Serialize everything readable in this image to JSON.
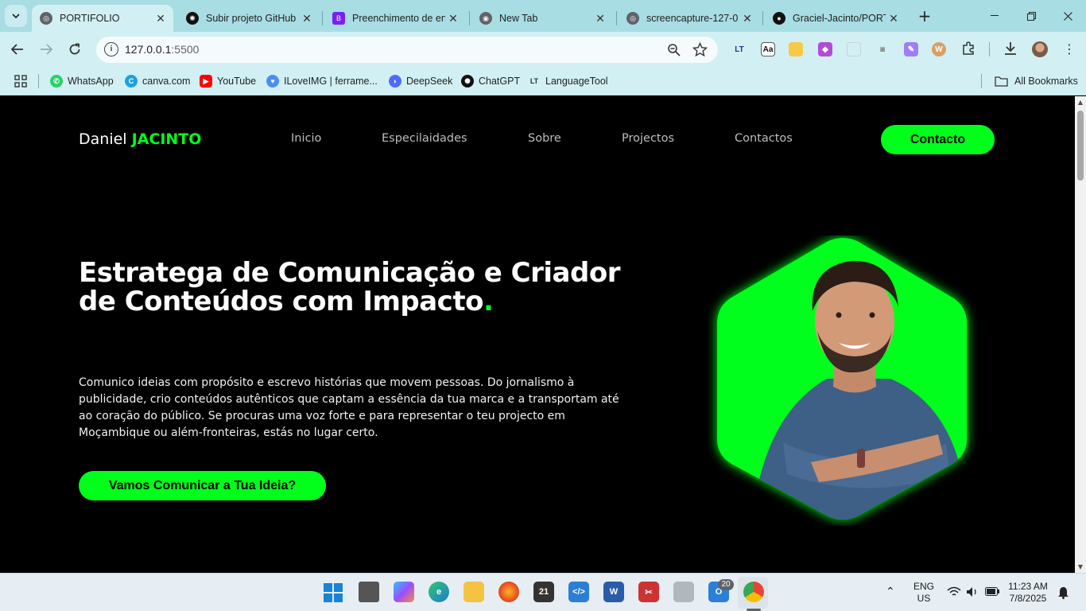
{
  "browser": {
    "tabs": [
      {
        "title": "PORTIFOLIO",
        "active": true,
        "icon": "globe-icon"
      },
      {
        "title": "Subir projeto GitHub",
        "active": false,
        "icon": "chatgpt-icon"
      },
      {
        "title": "Preenchimento de en",
        "active": false,
        "icon": "bootstrap-icon"
      },
      {
        "title": "New Tab",
        "active": false,
        "icon": "chrome-icon"
      },
      {
        "title": "screencapture-127-0",
        "active": false,
        "icon": "globe-icon"
      },
      {
        "title": "Graciel-Jacinto/PORT",
        "active": false,
        "icon": "github-icon"
      }
    ],
    "new_tab_label": "+",
    "url_host": "127.0.0.1",
    "url_port": ":5500",
    "bookmarks": [
      {
        "label": "WhatsApp",
        "icon": "whatsapp-icon",
        "color": "#25d366"
      },
      {
        "label": "canva.com",
        "icon": "canva-icon",
        "color": "#1ea0e0"
      },
      {
        "label": "YouTube",
        "icon": "youtube-icon",
        "color": "#ff0000"
      },
      {
        "label": "ILoveIMG | ferrame...",
        "icon": "iloveimg-icon",
        "color": "#4b8df8"
      },
      {
        "label": "DeepSeek",
        "icon": "deepseek-icon",
        "color": "#4d6bfe"
      },
      {
        "label": "ChatGPT",
        "icon": "chatgpt-icon",
        "color": "#111111"
      },
      {
        "label": "LanguageTool",
        "icon": "languagetool-icon",
        "color": "#333333"
      }
    ],
    "all_bookmarks": "All Bookmarks"
  },
  "site": {
    "brand_first": "Daniel",
    "brand_last": "JACINTO",
    "nav": [
      "Inicio",
      "Especilaidades",
      "Sobre",
      "Projectos",
      "Contactos"
    ],
    "cta_top": "Contacto",
    "hero_title": "Estratega de Comunicação e Criador de Conteúdos com Impacto",
    "hero_title_dot": ".",
    "hero_text": "Comunico ideias com propósito e escrevo histórias que movem pessoas. Do jornalismo à publicidade, crio conteúdos autênticos que captam a essência da tua marca e a transportam até ao coração do público. Se procuras uma voz forte e para representar o teu projecto em Moçambique ou além-fronteiras, estás no lugar certo.",
    "cta_hero": "Vamos Comunicar a Tua Ideia?",
    "accent_color": "#00ff1a"
  },
  "taskbar": {
    "lang_line1": "ENG",
    "lang_line2": "US",
    "time": "11:23 AM",
    "date": "7/8/2025",
    "badge_count": "20"
  }
}
